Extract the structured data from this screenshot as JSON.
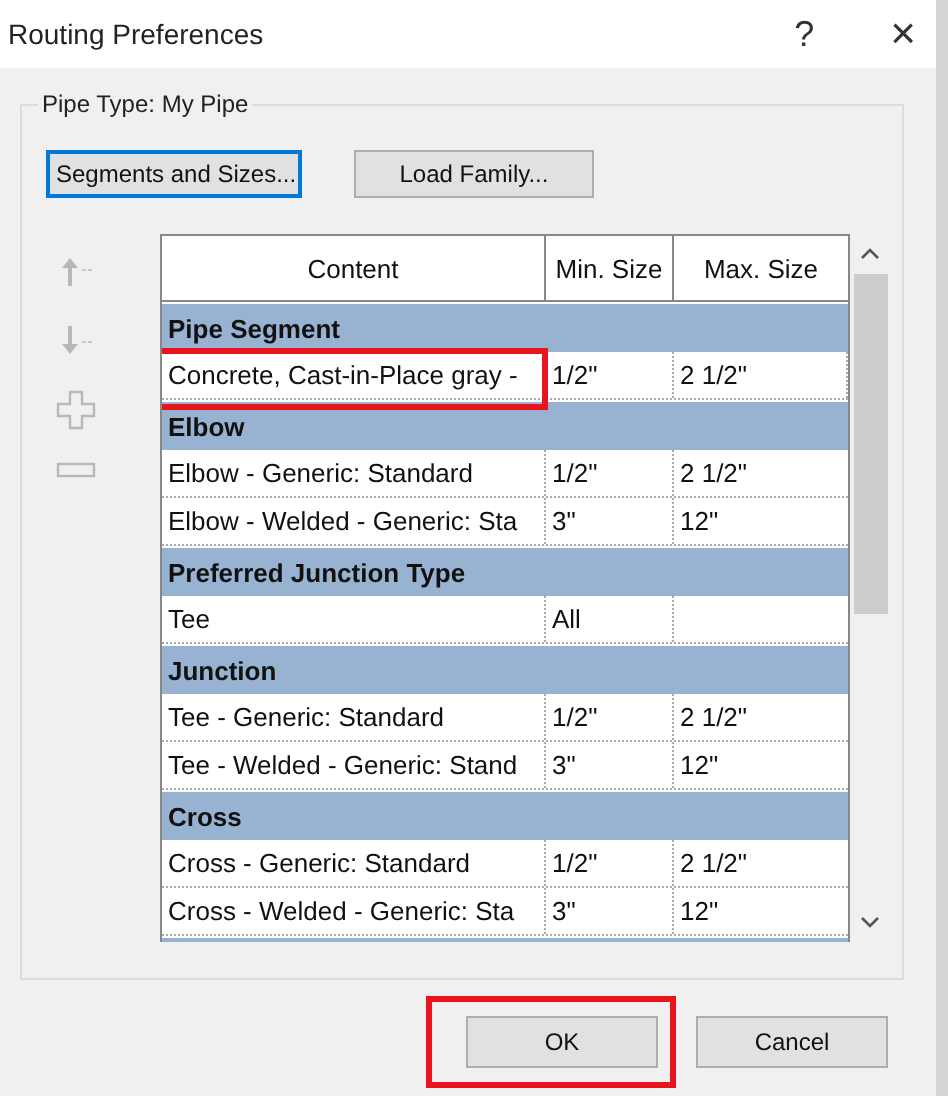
{
  "window": {
    "title": "Routing Preferences",
    "help": "?",
    "close": "×"
  },
  "pipe_type": "Pipe Type: My Pipe",
  "buttons": [
    {
      "label": "Segments and Sizes...",
      "focused": true
    },
    {
      "label": "Load Family...",
      "focused": false
    }
  ],
  "table": {
    "columns": [
      "Content",
      "Min. Size",
      "Max. Size"
    ],
    "sections": [
      {
        "heading": "Pipe Segment",
        "rows": [
          {
            "cells": [
              "Concrete, Cast-in-Place gray -",
              "1/2\"",
              "2 1/2\""
            ],
            "highlighted": true
          }
        ]
      },
      {
        "heading": "Elbow",
        "rows": [
          {
            "cells": [
              "Elbow - Generic: Standard",
              "1/2\"",
              "2 1/2\""
            ],
            "highlighted": false
          },
          {
            "cells": [
              "Elbow - Welded - Generic: Sta",
              "3\"",
              "12\""
            ],
            "highlighted": false
          }
        ]
      },
      {
        "heading": "Preferred Junction Type",
        "rows": [
          {
            "cells": [
              "Tee",
              "All",
              ""
            ],
            "highlighted": false
          }
        ]
      },
      {
        "heading": "Junction",
        "rows": [
          {
            "cells": [
              "Tee - Generic: Standard",
              "1/2\"",
              "2 1/2\""
            ],
            "highlighted": false
          },
          {
            "cells": [
              "Tee - Welded - Generic: Stand",
              "3\"",
              "12\""
            ],
            "highlighted": false
          }
        ]
      },
      {
        "heading": "Cross",
        "rows": [
          {
            "cells": [
              "Cross - Generic: Standard",
              "1/2\"",
              "2 1/2\""
            ],
            "highlighted": false
          },
          {
            "cells": [
              "Cross - Welded - Generic: Sta",
              "3\"",
              "12\""
            ],
            "highlighted": false
          }
        ]
      }
    ]
  },
  "footer": [
    {
      "label": "OK",
      "highlighted": true
    },
    {
      "label": "Cancel",
      "highlighted": false
    }
  ]
}
